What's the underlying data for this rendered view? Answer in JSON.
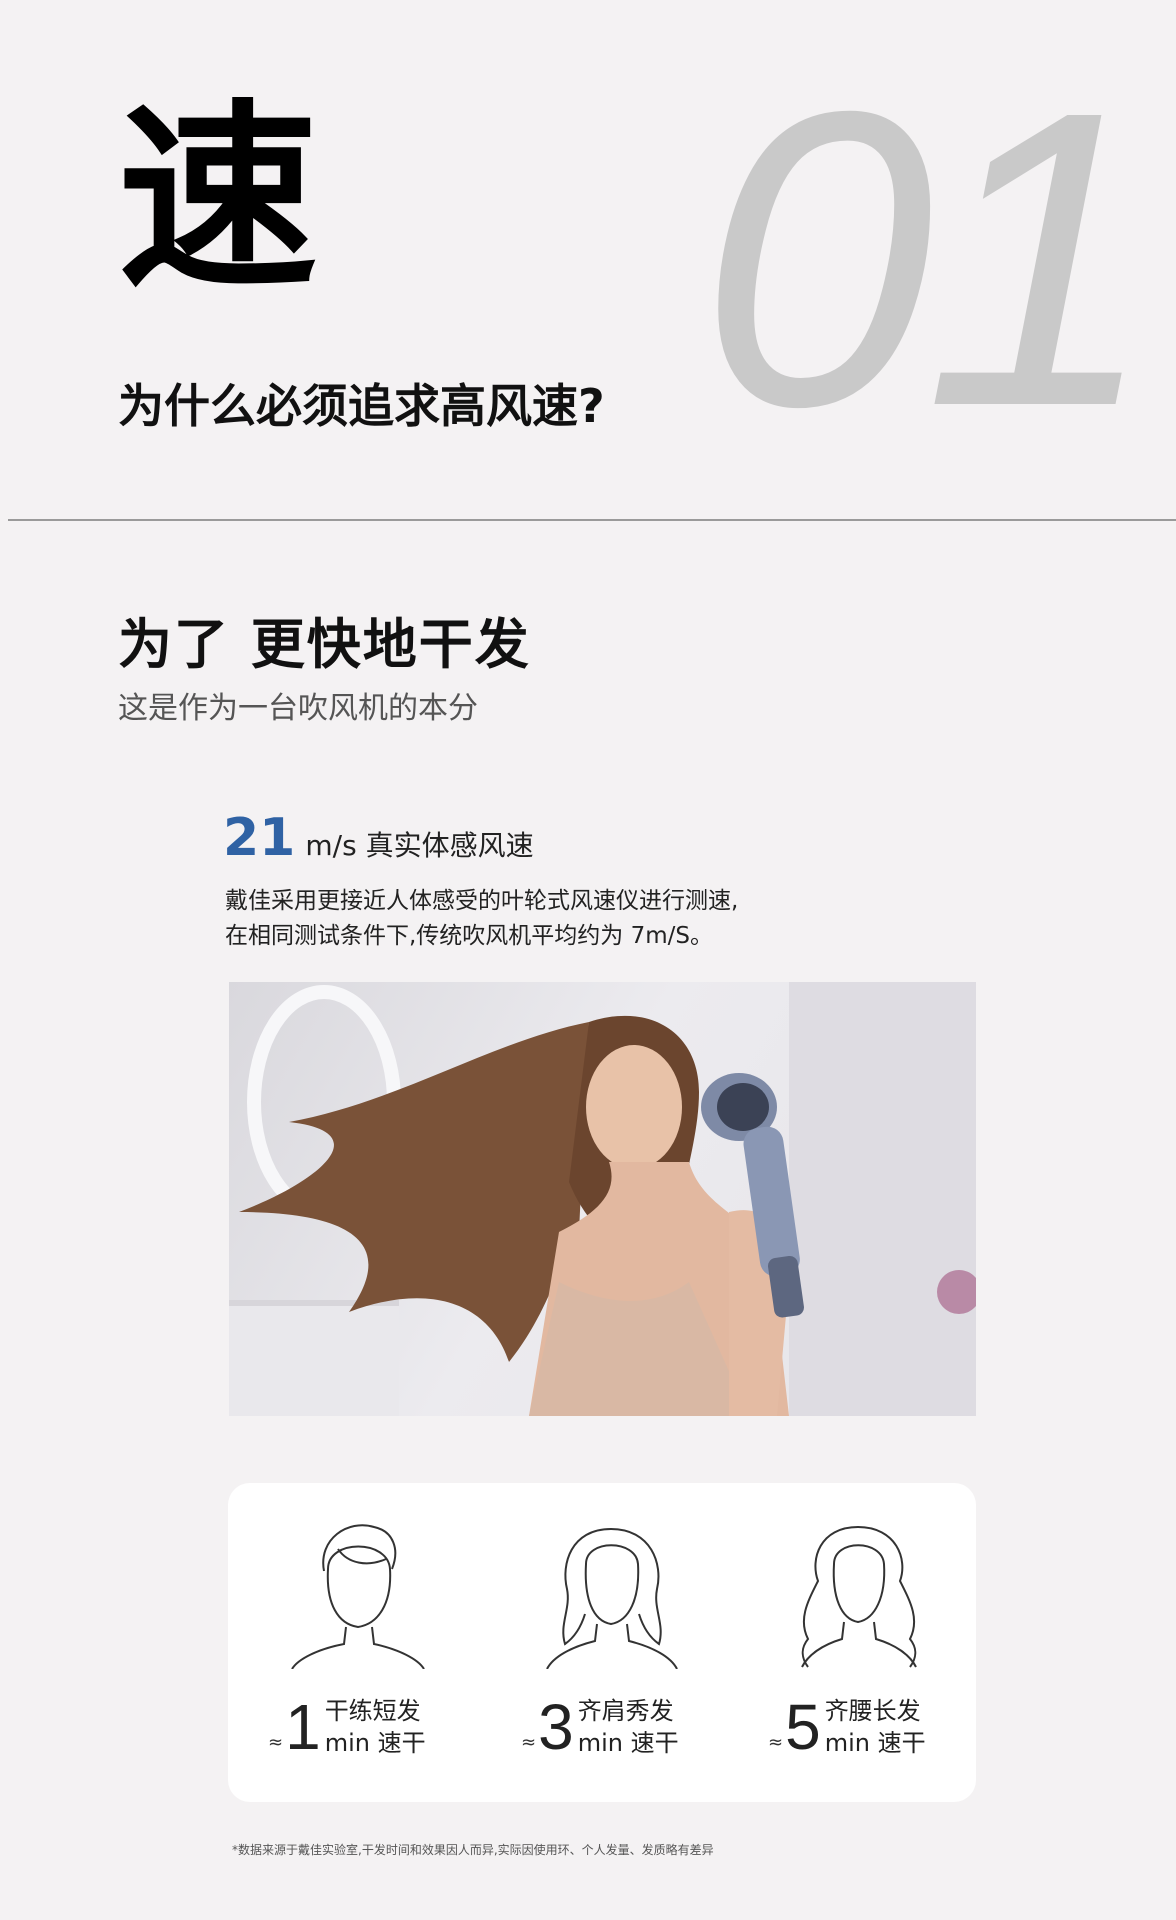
{
  "hero": {
    "char": "速",
    "number": "01",
    "question": "为什么必须追求高风速?"
  },
  "section": {
    "title": "为了 更快地干发",
    "subtitle": "这是作为一台吹风机的本分"
  },
  "speed": {
    "value": "21",
    "label": "m/s 真实体感风速",
    "desc_line1": "戴佳采用更接近人体感受的叶轮式风速仪进行测速,",
    "desc_line2": "在相同测试条件下,传统吹风机平均约为 7m/S。"
  },
  "styles": [
    {
      "approx": "≈",
      "num": "1",
      "name": "干练短发",
      "unit": "min 速干"
    },
    {
      "approx": "≈",
      "num": "3",
      "name": "齐肩秀发",
      "unit": "min 速干"
    },
    {
      "approx": "≈",
      "num": "5",
      "name": "齐腰长发",
      "unit": "min 速干"
    }
  ],
  "footnote": "*数据来源于戴佳实验室,干发时间和效果因人而异,实际因使用环、个人发量、发质略有差异",
  "colors": {
    "accent": "#2f62a4",
    "background": "#f4f2f3",
    "number_gray": "#c9c9c9"
  }
}
